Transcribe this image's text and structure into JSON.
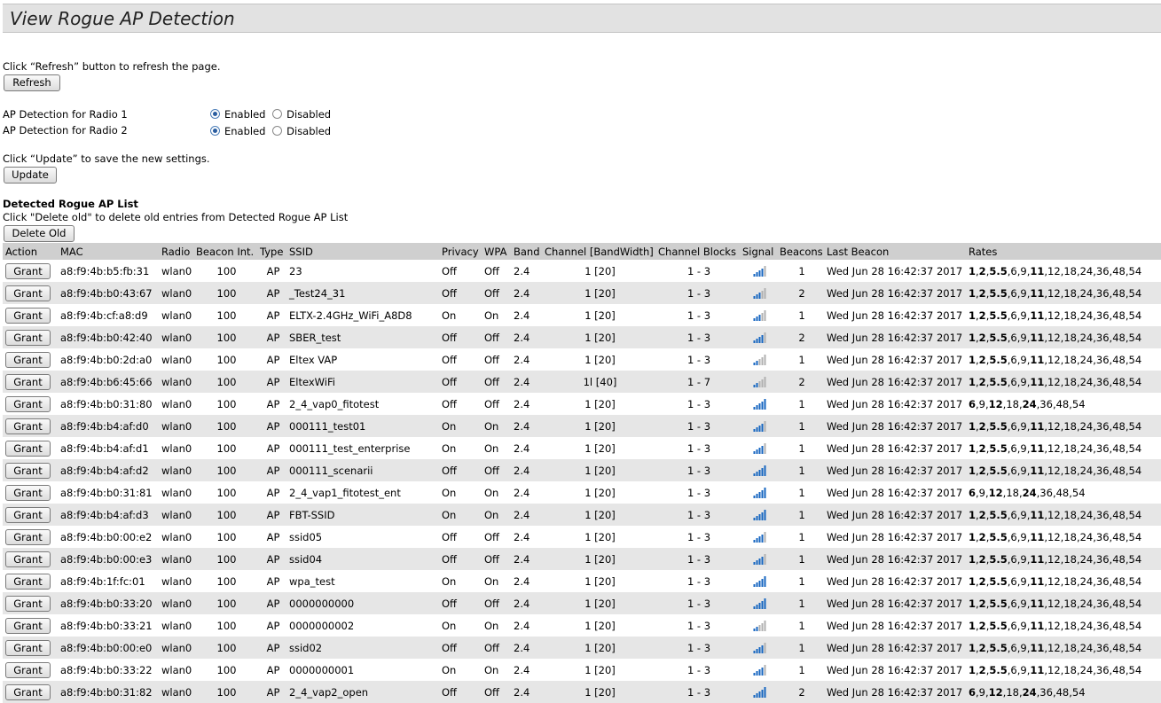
{
  "page": {
    "title": "View Rogue AP Detection",
    "refresh_hint": "Click “Refresh” button to refresh the page.",
    "refresh_label": "Refresh",
    "update_hint": "Click “Update” to save the new settings.",
    "update_label": "Update",
    "list_title": "Detected Rogue AP List",
    "delete_hint": "Click \"Delete old\" to delete old entries from Detected Rogue AP List",
    "delete_label": "Delete Old"
  },
  "radios": [
    {
      "label": "AP Detection for Radio 1",
      "enabled_label": "Enabled",
      "disabled_label": "Disabled",
      "selected": "Enabled"
    },
    {
      "label": "AP Detection for Radio 2",
      "enabled_label": "Enabled",
      "disabled_label": "Disabled",
      "selected": "Enabled"
    }
  ],
  "table": {
    "grant_label": "Grant",
    "columns": [
      "Action",
      "MAC",
      "Radio",
      "Beacon Int.",
      "Type",
      "SSID",
      "Privacy",
      "WPA",
      "Band",
      "Channel [BandWidth]",
      "Channel Blocks",
      "Signal",
      "Beacons",
      "Last Beacon",
      "Rates"
    ],
    "colors": {
      "header_bg": "#cfcfcf",
      "alt_row_bg": "#e6e6e6",
      "signal_blue": "#1565c0",
      "signal_gray": "#b0b0b0"
    },
    "rows": [
      {
        "mac": "a8:f9:4b:b5:fb:31",
        "radio": "wlan0",
        "beacon_int": "100",
        "type": "AP",
        "ssid": "23",
        "privacy": "Off",
        "wpa": "Off",
        "band": "2.4",
        "channel": "1 [20]",
        "blocks": "1 - 3",
        "signal": 3,
        "beacons": "1",
        "last_beacon": "Wed Jun 28 16:42:37 2017",
        "rates": "1,2,5.5,6,9,11,12,18,24,36,48,54",
        "rates_bold": [
          "1",
          "2",
          "5.5",
          "11"
        ]
      },
      {
        "mac": "a8:f9:4b:b0:43:67",
        "radio": "wlan0",
        "beacon_int": "100",
        "type": "AP",
        "ssid": "_Test24_31",
        "privacy": "Off",
        "wpa": "Off",
        "band": "2.4",
        "channel": "1 [20]",
        "blocks": "1 - 3",
        "signal": 2,
        "beacons": "2",
        "last_beacon": "Wed Jun 28 16:42:37 2017",
        "rates": "1,2,5.5,6,9,11,12,18,24,36,48,54",
        "rates_bold": [
          "1",
          "2",
          "5.5",
          "11"
        ]
      },
      {
        "mac": "a8:f9:4b:cf:a8:d9",
        "radio": "wlan0",
        "beacon_int": "100",
        "type": "AP",
        "ssid": "ELTX-2.4GHz_WiFi_A8D8",
        "privacy": "On",
        "wpa": "On",
        "band": "2.4",
        "channel": "1 [20]",
        "blocks": "1 - 3",
        "signal": 2,
        "beacons": "1",
        "last_beacon": "Wed Jun 28 16:42:37 2017",
        "rates": "1,2,5.5,6,9,11,12,18,24,36,48,54",
        "rates_bold": [
          "1",
          "2",
          "5.5",
          "11"
        ]
      },
      {
        "mac": "a8:f9:4b:b0:42:40",
        "radio": "wlan0",
        "beacon_int": "100",
        "type": "AP",
        "ssid": "SBER_test",
        "privacy": "Off",
        "wpa": "Off",
        "band": "2.4",
        "channel": "1 [20]",
        "blocks": "1 - 3",
        "signal": 3,
        "beacons": "2",
        "last_beacon": "Wed Jun 28 16:42:37 2017",
        "rates": "1,2,5.5,6,9,11,12,18,24,36,48,54",
        "rates_bold": [
          "1",
          "2",
          "5.5",
          "11"
        ]
      },
      {
        "mac": "a8:f9:4b:b0:2d:a0",
        "radio": "wlan0",
        "beacon_int": "100",
        "type": "AP",
        "ssid": "Eltex VAP",
        "privacy": "Off",
        "wpa": "Off",
        "band": "2.4",
        "channel": "1 [20]",
        "blocks": "1 - 3",
        "signal": 1,
        "beacons": "1",
        "last_beacon": "Wed Jun 28 16:42:37 2017",
        "rates": "1,2,5.5,6,9,11,12,18,24,36,48,54",
        "rates_bold": [
          "1",
          "2",
          "5.5",
          "11"
        ]
      },
      {
        "mac": "a8:f9:4b:b6:45:66",
        "radio": "wlan0",
        "beacon_int": "100",
        "type": "AP",
        "ssid": "EltexWiFi",
        "privacy": "Off",
        "wpa": "Off",
        "band": "2.4",
        "channel": "1l [40]",
        "blocks": "1 - 7",
        "signal": 1,
        "beacons": "2",
        "last_beacon": "Wed Jun 28 16:42:37 2017",
        "rates": "1,2,5.5,6,9,11,12,18,24,36,48,54",
        "rates_bold": [
          "1",
          "2",
          "5.5",
          "11"
        ]
      },
      {
        "mac": "a8:f9:4b:b0:31:80",
        "radio": "wlan0",
        "beacon_int": "100",
        "type": "AP",
        "ssid": "2_4_vap0_fitotest",
        "privacy": "Off",
        "wpa": "Off",
        "band": "2.4",
        "channel": "1 [20]",
        "blocks": "1 - 3",
        "signal": 4,
        "beacons": "1",
        "last_beacon": "Wed Jun 28 16:42:37 2017",
        "rates": "6,9,12,18,24,36,48,54",
        "rates_bold": [
          "6",
          "12",
          "24"
        ]
      },
      {
        "mac": "a8:f9:4b:b4:af:d0",
        "radio": "wlan0",
        "beacon_int": "100",
        "type": "AP",
        "ssid": "000111_test01",
        "privacy": "On",
        "wpa": "On",
        "band": "2.4",
        "channel": "1 [20]",
        "blocks": "1 - 3",
        "signal": 3,
        "beacons": "1",
        "last_beacon": "Wed Jun 28 16:42:37 2017",
        "rates": "1,2,5.5,6,9,11,12,18,24,36,48,54",
        "rates_bold": [
          "1",
          "2",
          "5.5",
          "11"
        ]
      },
      {
        "mac": "a8:f9:4b:b4:af:d1",
        "radio": "wlan0",
        "beacon_int": "100",
        "type": "AP",
        "ssid": "000111_test_enterprise",
        "privacy": "On",
        "wpa": "On",
        "band": "2.4",
        "channel": "1 [20]",
        "blocks": "1 - 3",
        "signal": 3,
        "beacons": "1",
        "last_beacon": "Wed Jun 28 16:42:37 2017",
        "rates": "1,2,5.5,6,9,11,12,18,24,36,48,54",
        "rates_bold": [
          "1",
          "2",
          "5.5",
          "11"
        ]
      },
      {
        "mac": "a8:f9:4b:b4:af:d2",
        "radio": "wlan0",
        "beacon_int": "100",
        "type": "AP",
        "ssid": "000111_scenarii",
        "privacy": "Off",
        "wpa": "Off",
        "band": "2.4",
        "channel": "1 [20]",
        "blocks": "1 - 3",
        "signal": 4,
        "beacons": "1",
        "last_beacon": "Wed Jun 28 16:42:37 2017",
        "rates": "1,2,5.5,6,9,11,12,18,24,36,48,54",
        "rates_bold": [
          "1",
          "2",
          "5.5",
          "11"
        ]
      },
      {
        "mac": "a8:f9:4b:b0:31:81",
        "radio": "wlan0",
        "beacon_int": "100",
        "type": "AP",
        "ssid": "2_4_vap1_fitotest_ent",
        "privacy": "On",
        "wpa": "On",
        "band": "2.4",
        "channel": "1 [20]",
        "blocks": "1 - 3",
        "signal": 4,
        "beacons": "1",
        "last_beacon": "Wed Jun 28 16:42:37 2017",
        "rates": "6,9,12,18,24,36,48,54",
        "rates_bold": [
          "6",
          "12",
          "24"
        ]
      },
      {
        "mac": "a8:f9:4b:b4:af:d3",
        "radio": "wlan0",
        "beacon_int": "100",
        "type": "AP",
        "ssid": "FBT-SSID",
        "privacy": "On",
        "wpa": "On",
        "band": "2.4",
        "channel": "1 [20]",
        "blocks": "1 - 3",
        "signal": 4,
        "beacons": "1",
        "last_beacon": "Wed Jun 28 16:42:37 2017",
        "rates": "1,2,5.5,6,9,11,12,18,24,36,48,54",
        "rates_bold": [
          "1",
          "2",
          "5.5",
          "11"
        ]
      },
      {
        "mac": "a8:f9:4b:b0:00:e2",
        "radio": "wlan0",
        "beacon_int": "100",
        "type": "AP",
        "ssid": "ssid05",
        "privacy": "Off",
        "wpa": "Off",
        "band": "2.4",
        "channel": "1 [20]",
        "blocks": "1 - 3",
        "signal": 3,
        "beacons": "1",
        "last_beacon": "Wed Jun 28 16:42:37 2017",
        "rates": "1,2,5.5,6,9,11,12,18,24,36,48,54",
        "rates_bold": [
          "1",
          "2",
          "5.5",
          "11"
        ]
      },
      {
        "mac": "a8:f9:4b:b0:00:e3",
        "radio": "wlan0",
        "beacon_int": "100",
        "type": "AP",
        "ssid": "ssid04",
        "privacy": "Off",
        "wpa": "Off",
        "band": "2.4",
        "channel": "1 [20]",
        "blocks": "1 - 3",
        "signal": 3,
        "beacons": "1",
        "last_beacon": "Wed Jun 28 16:42:37 2017",
        "rates": "1,2,5.5,6,9,11,12,18,24,36,48,54",
        "rates_bold": [
          "1",
          "2",
          "5.5",
          "11"
        ]
      },
      {
        "mac": "a8:f9:4b:1f:fc:01",
        "radio": "wlan0",
        "beacon_int": "100",
        "type": "AP",
        "ssid": "wpa_test",
        "privacy": "On",
        "wpa": "On",
        "band": "2.4",
        "channel": "1 [20]",
        "blocks": "1 - 3",
        "signal": 4,
        "beacons": "1",
        "last_beacon": "Wed Jun 28 16:42:37 2017",
        "rates": "1,2,5.5,6,9,11,12,18,24,36,48,54",
        "rates_bold": [
          "1",
          "2",
          "5.5",
          "11"
        ]
      },
      {
        "mac": "a8:f9:4b:b0:33:20",
        "radio": "wlan0",
        "beacon_int": "100",
        "type": "AP",
        "ssid": "0000000000",
        "privacy": "Off",
        "wpa": "Off",
        "band": "2.4",
        "channel": "1 [20]",
        "blocks": "1 - 3",
        "signal": 4,
        "beacons": "1",
        "last_beacon": "Wed Jun 28 16:42:37 2017",
        "rates": "1,2,5.5,6,9,11,12,18,24,36,48,54",
        "rates_bold": [
          "1",
          "2",
          "5.5",
          "11"
        ]
      },
      {
        "mac": "a8:f9:4b:b0:33:21",
        "radio": "wlan0",
        "beacon_int": "100",
        "type": "AP",
        "ssid": "0000000002",
        "privacy": "On",
        "wpa": "On",
        "band": "2.4",
        "channel": "1 [20]",
        "blocks": "1 - 3",
        "signal": 1,
        "beacons": "1",
        "last_beacon": "Wed Jun 28 16:42:37 2017",
        "rates": "1,2,5.5,6,9,11,12,18,24,36,48,54",
        "rates_bold": [
          "1",
          "2",
          "5.5",
          "11"
        ]
      },
      {
        "mac": "a8:f9:4b:b0:00:e0",
        "radio": "wlan0",
        "beacon_int": "100",
        "type": "AP",
        "ssid": "ssid02",
        "privacy": "Off",
        "wpa": "Off",
        "band": "2.4",
        "channel": "1 [20]",
        "blocks": "1 - 3",
        "signal": 3,
        "beacons": "1",
        "last_beacon": "Wed Jun 28 16:42:37 2017",
        "rates": "1,2,5.5,6,9,11,12,18,24,36,48,54",
        "rates_bold": [
          "1",
          "2",
          "5.5",
          "11"
        ]
      },
      {
        "mac": "a8:f9:4b:b0:33:22",
        "radio": "wlan0",
        "beacon_int": "100",
        "type": "AP",
        "ssid": "0000000001",
        "privacy": "On",
        "wpa": "On",
        "band": "2.4",
        "channel": "1 [20]",
        "blocks": "1 - 3",
        "signal": 3,
        "beacons": "1",
        "last_beacon": "Wed Jun 28 16:42:37 2017",
        "rates": "1,2,5.5,6,9,11,12,18,24,36,48,54",
        "rates_bold": [
          "1",
          "2",
          "5.5",
          "11"
        ]
      },
      {
        "mac": "a8:f9:4b:b0:31:82",
        "radio": "wlan0",
        "beacon_int": "100",
        "type": "AP",
        "ssid": "2_4_vap2_open",
        "privacy": "Off",
        "wpa": "Off",
        "band": "2.4",
        "channel": "1 [20]",
        "blocks": "1 - 3",
        "signal": 4,
        "beacons": "2",
        "last_beacon": "Wed Jun 28 16:42:37 2017",
        "rates": "6,9,12,18,24,36,48,54",
        "rates_bold": [
          "6",
          "12",
          "24"
        ]
      }
    ]
  }
}
